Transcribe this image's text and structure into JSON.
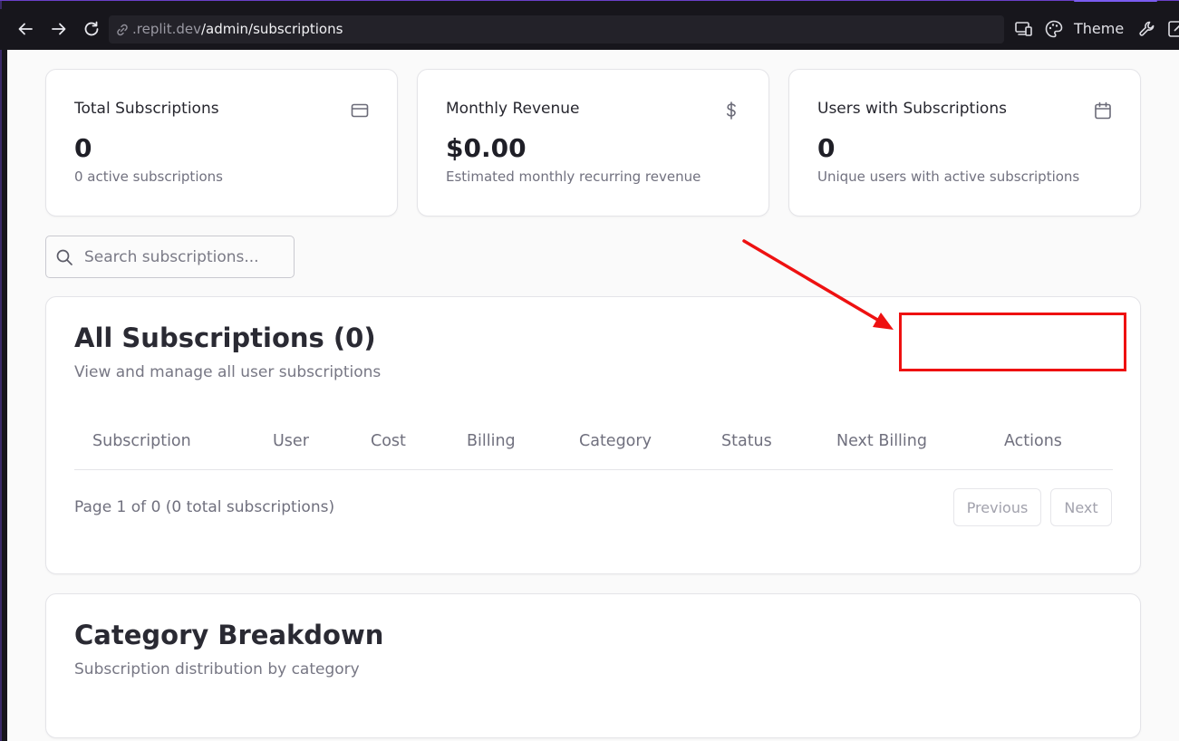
{
  "browser": {
    "url_host": ".replit.dev",
    "url_path": "/admin/subscriptions",
    "theme_label": "Theme",
    "icons": [
      "back-arrow-icon",
      "forward-arrow-icon",
      "reload-icon",
      "link-icon",
      "devices-icon",
      "palette-icon",
      "wrench-icon",
      "external-icon"
    ]
  },
  "stats": [
    {
      "title": "Total Subscriptions",
      "value": "0",
      "sub": "0 active subscriptions",
      "icon": "credit-card-icon"
    },
    {
      "title": "Monthly Revenue",
      "value": "$0.00",
      "sub": "Estimated monthly recurring revenue",
      "icon": "dollar-icon"
    },
    {
      "title": "Users with Subscriptions",
      "value": "0",
      "sub": "Unique users with active subscriptions",
      "icon": "calendar-icon"
    }
  ],
  "search": {
    "placeholder": "Search subscriptions..."
  },
  "subscriptions": {
    "title": "All Subscriptions (0)",
    "subtitle": "View and manage all user subscriptions",
    "columns": [
      "Subscription",
      "User",
      "Cost",
      "Billing",
      "Category",
      "Status",
      "Next Billing",
      "Actions"
    ],
    "page_info": "Page 1 of 0 (0 total subscriptions)",
    "previous_label": "Previous",
    "next_label": "Next"
  },
  "category": {
    "title": "Category Breakdown",
    "subtitle": "Subscription distribution by category"
  },
  "colors": {
    "annotation": "#ee1111",
    "browser_bg": "#17161c",
    "page_bg": "#fafafa"
  }
}
